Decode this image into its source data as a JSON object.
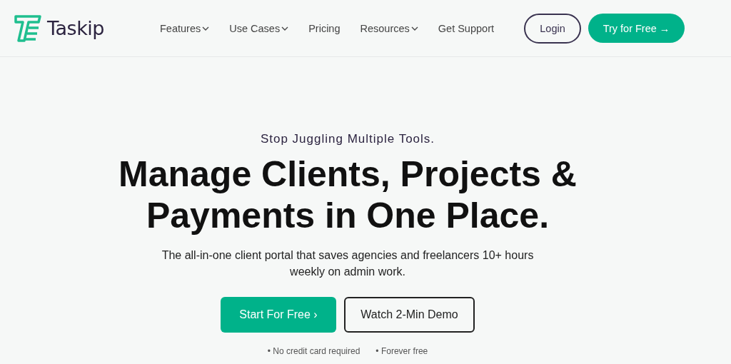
{
  "header": {
    "logo": "Taskip",
    "nav": [
      {
        "label": "Features",
        "dropdown": true
      },
      {
        "label": "Use Cases",
        "dropdown": true
      },
      {
        "label": "Pricing",
        "dropdown": false
      },
      {
        "label": "Resources",
        "dropdown": true
      },
      {
        "label": "Get Support",
        "dropdown": false
      }
    ],
    "login": "Login",
    "cta": "Try for Free →"
  },
  "hero": {
    "eyebrow": "Stop Juggling Multiple Tools.",
    "headline": "Manage Clients, Projects & Payments in One Place.",
    "subtitle": "The all-in-one client portal that saves agencies and freelancers 10+ hours weekly on admin work.",
    "primary": "Start For Free ›",
    "secondary": "Watch 2-Min Demo",
    "notes": [
      "• No credit card required",
      "• Forever free"
    ]
  }
}
